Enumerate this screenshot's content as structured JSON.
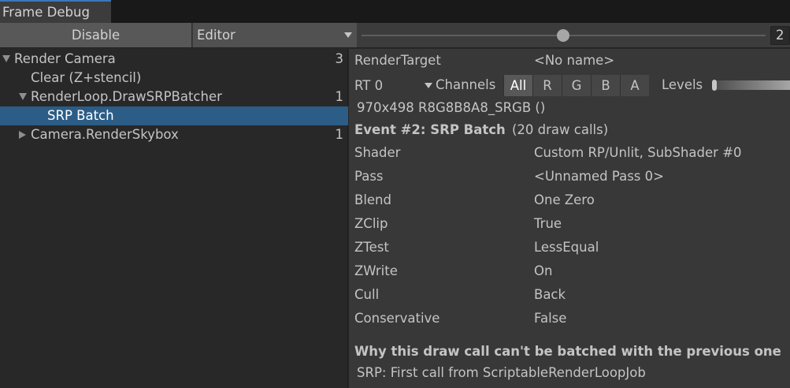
{
  "window": {
    "tab_title": "Frame Debug"
  },
  "toolbar": {
    "disable_label": "Disable",
    "target_dropdown": "Editor",
    "event_index": "2",
    "slider_fraction": 0.5
  },
  "tree": [
    {
      "label": "Render Camera",
      "count": "3",
      "expanded": true
    },
    {
      "label": "Clear (Z+stencil)",
      "count": ""
    },
    {
      "label": "RenderLoop.DrawSRPBatcher",
      "count": "1",
      "expanded": true
    },
    {
      "label": "SRP Batch",
      "count": "",
      "selected": true
    },
    {
      "label": "Camera.RenderSkybox",
      "count": "1",
      "expanded": false
    }
  ],
  "detail": {
    "render_target_label": "RenderTarget",
    "render_target_value": "<No name>",
    "rt_select": "RT 0",
    "channels_label": "Channels",
    "channels": [
      "All",
      "R",
      "G",
      "B",
      "A"
    ],
    "active_channel": "All",
    "levels_label": "Levels",
    "format_line": "970x498 R8G8B8A8_SRGB ()",
    "event_title": "Event #2: SRP Batch",
    "event_calls": "(20 draw calls)",
    "properties": [
      {
        "key": "Shader",
        "value": "Custom RP/Unlit, SubShader #0"
      },
      {
        "key": "Pass",
        "value": "<Unnamed Pass 0>"
      },
      {
        "key": "Blend",
        "value": "One Zero"
      },
      {
        "key": "ZClip",
        "value": "True"
      },
      {
        "key": "ZTest",
        "value": "LessEqual"
      },
      {
        "key": "ZWrite",
        "value": "On"
      },
      {
        "key": "Cull",
        "value": "Back"
      },
      {
        "key": "Conservative",
        "value": "False"
      }
    ],
    "batch_heading": "Why this draw call can't be batched with the previous one",
    "batch_reason": "SRP: First call from ScriptableRenderLoopJob"
  },
  "colors": {
    "selection": "#2c5d87",
    "tab_accent": "#3a79bb",
    "panel_bg": "#383838",
    "tree_bg": "#282828"
  }
}
